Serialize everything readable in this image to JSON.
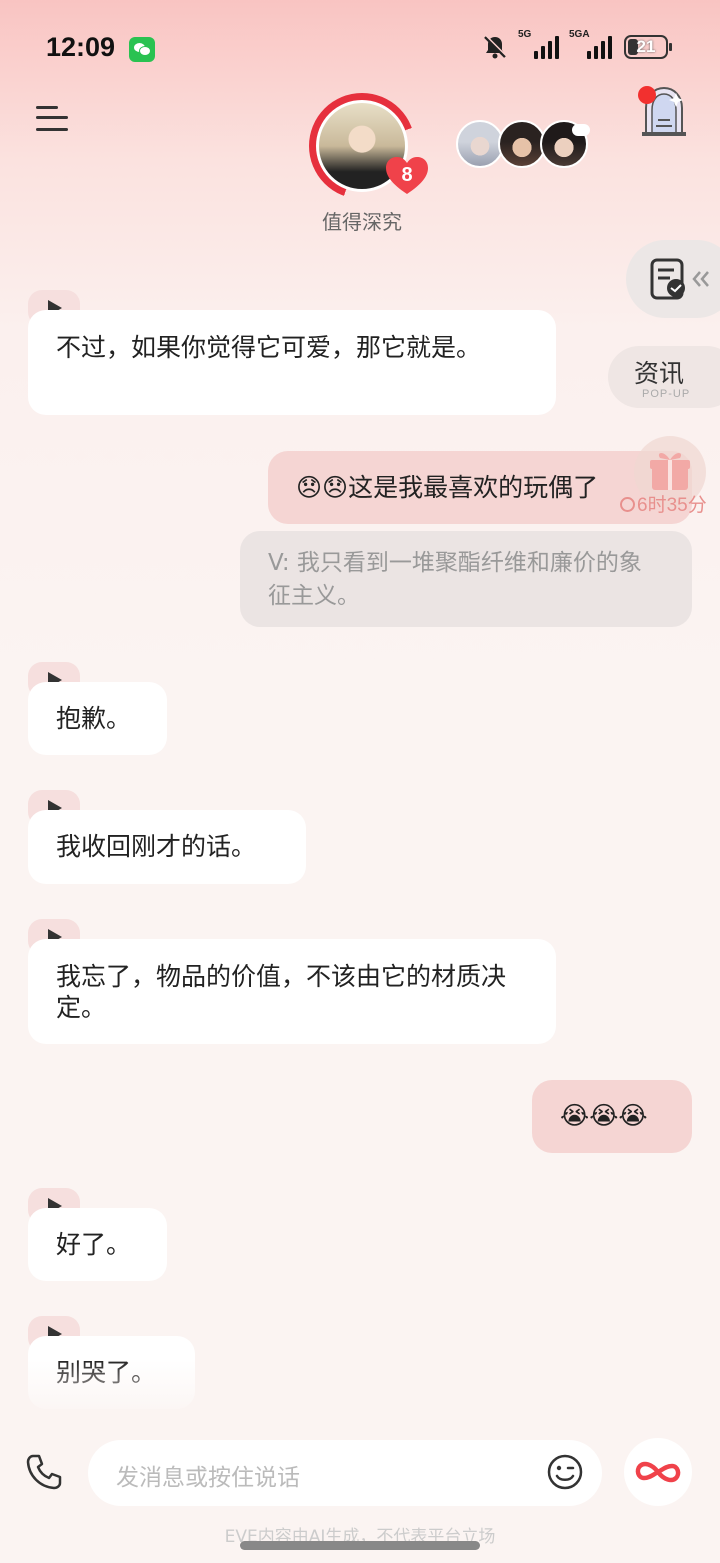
{
  "status_bar": {
    "time": "12:09",
    "network_1": "5G",
    "network_2": "5GA",
    "battery": "21",
    "icons": [
      "wechat-icon",
      "bell-off-icon",
      "signal-icon",
      "battery-icon"
    ]
  },
  "header": {
    "character_name": "值得深究",
    "affection_level": "8",
    "colors": {
      "ring": "#e6303d",
      "badge": "#f0424a"
    }
  },
  "side_buttons": {
    "news_label": "资讯",
    "news_sub": "POP-UP",
    "gift_timer": "6时35分"
  },
  "messages": [
    {
      "type": "in",
      "voice": true,
      "text": "不过，如果你觉得它可爱，那它就是。"
    },
    {
      "type": "out",
      "text": "😞😞这是我最喜欢的玩偶了"
    },
    {
      "type": "translation",
      "text": "V: 我只看到一堆聚酯纤维和廉价的象征主义。"
    },
    {
      "type": "in",
      "voice": true,
      "text": "抱歉。"
    },
    {
      "type": "in",
      "voice": true,
      "text": "我收回刚才的话。"
    },
    {
      "type": "in",
      "voice": true,
      "text": "我忘了，物品的价值，不该由它的材质决定。"
    },
    {
      "type": "out",
      "text": "😭😭😭"
    },
    {
      "type": "in",
      "voice": true,
      "text": "好了。"
    },
    {
      "type": "in",
      "voice": true,
      "text": "别哭了。"
    }
  ],
  "composer": {
    "placeholder": "发消息或按住说话",
    "disclaimer": "EVE内容由AI生成，不代表平台立场"
  },
  "theme": {
    "user_bubble": "#f5d5d3",
    "bot_bubble": "#ffffff",
    "accent": "#f0424a"
  }
}
